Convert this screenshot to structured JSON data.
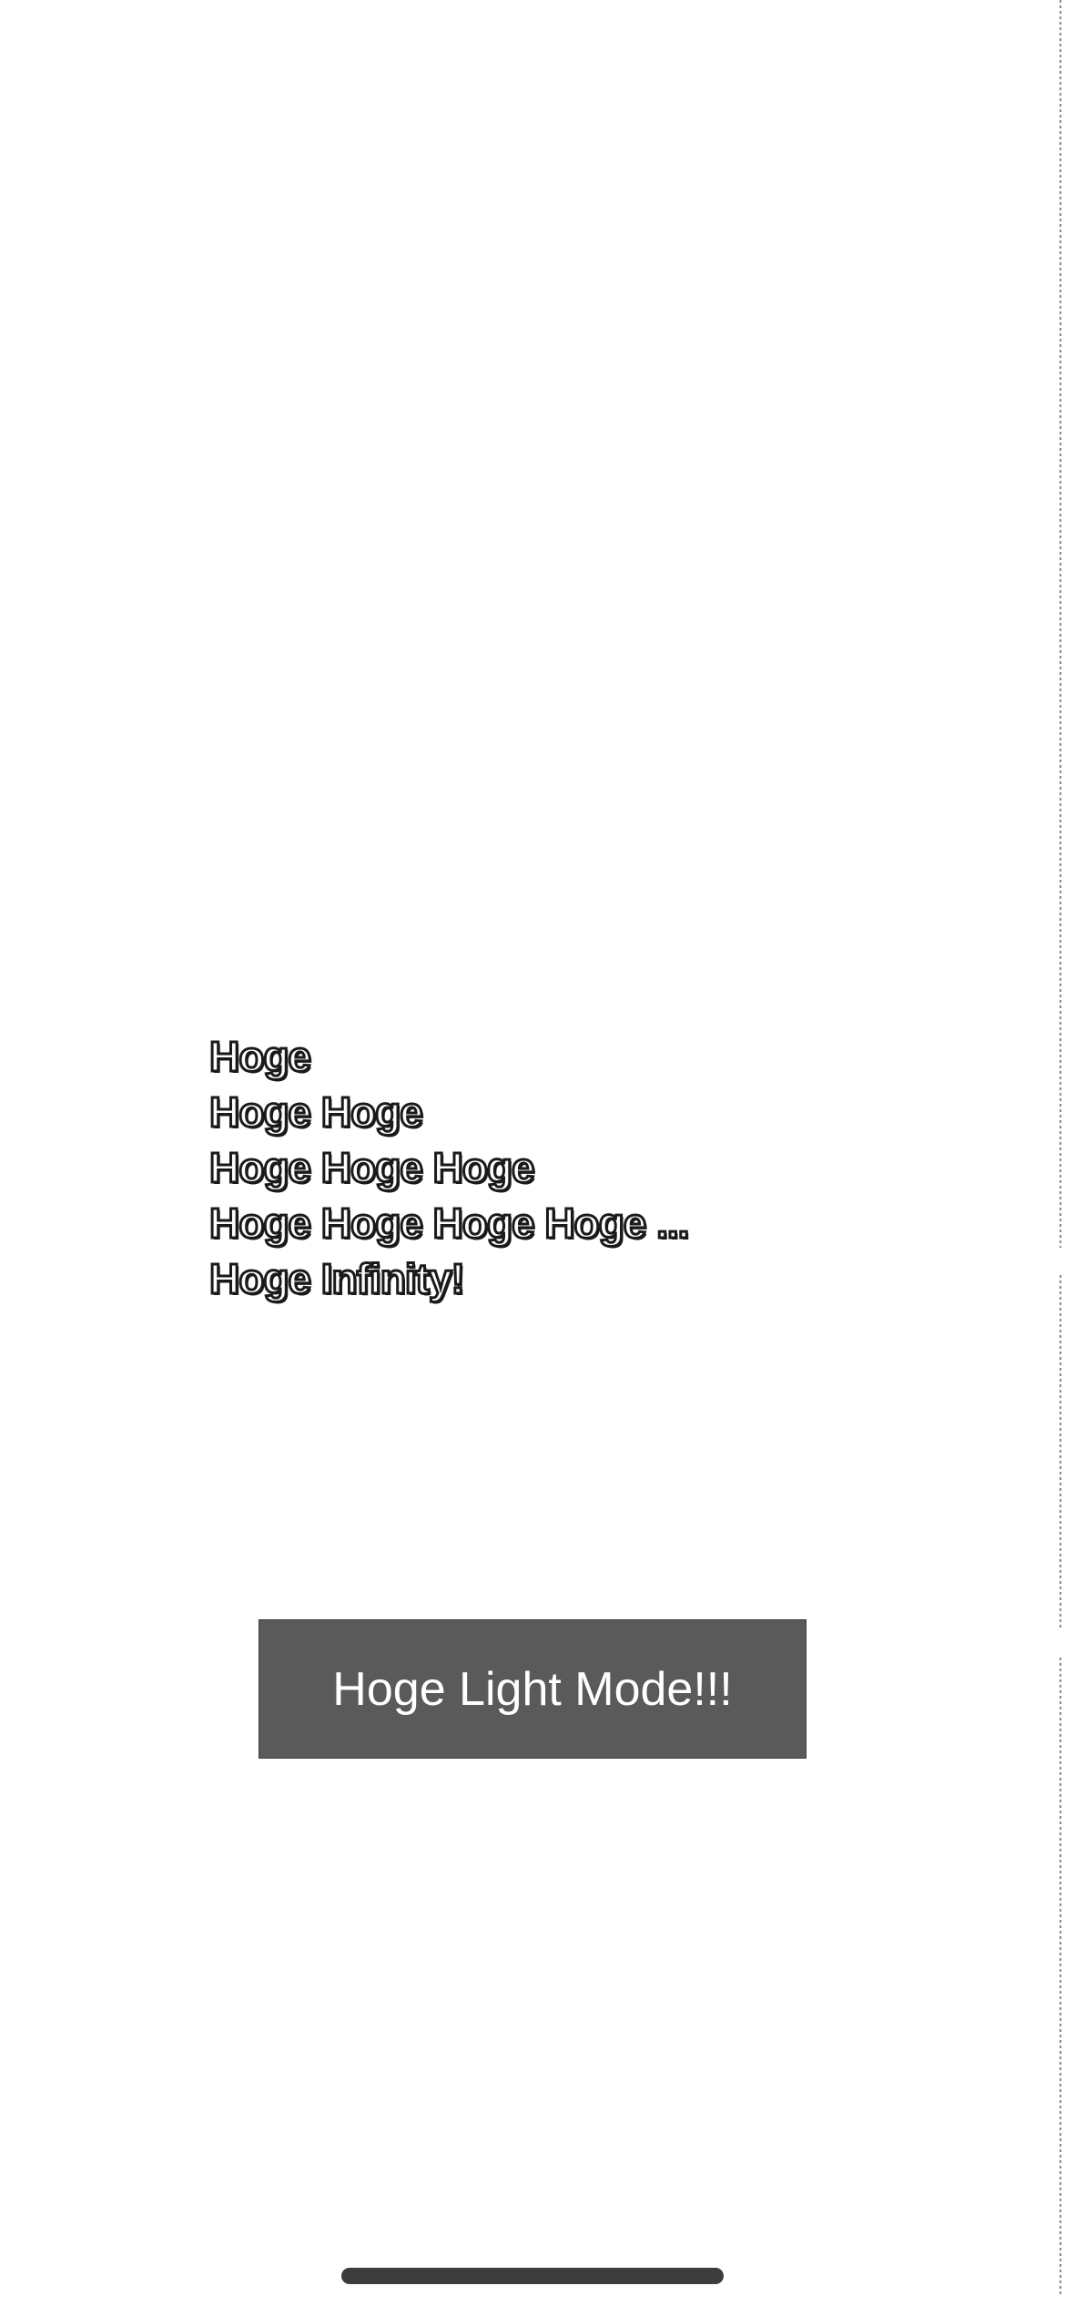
{
  "content": {
    "lines": [
      "Hoge",
      "Hoge Hoge",
      "Hoge Hoge Hoge",
      "Hoge Hoge Hoge Hoge ...",
      "Hoge Infinity!"
    ]
  },
  "action": {
    "button_label": "Hoge Light Mode!!!"
  },
  "colors": {
    "background": "#ffffff",
    "button_bg": "#5a5a5a",
    "button_text": "#ffffff",
    "text_outline": "#1a1a1a",
    "home_indicator": "#3c3c3c"
  }
}
